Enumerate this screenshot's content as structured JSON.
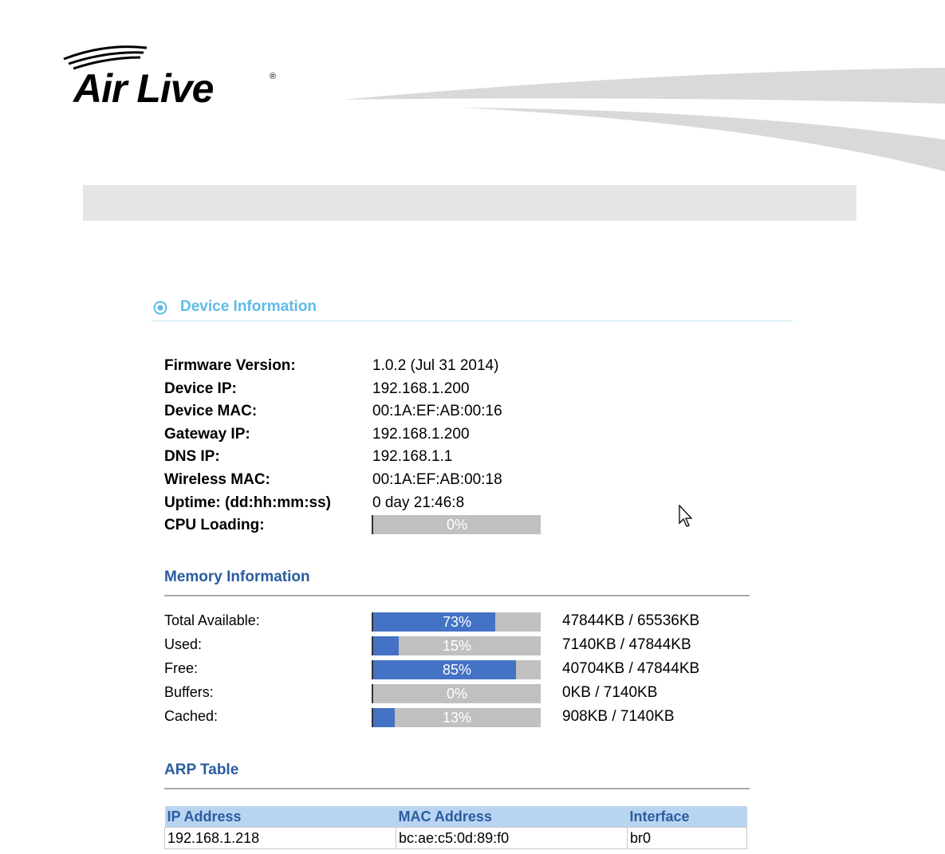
{
  "brand": {
    "logo_text": "Air Live",
    "registered_mark": "®"
  },
  "device_information": {
    "title": "Device Information",
    "rows": [
      {
        "label": "Firmware Version:",
        "value": "1.0.2 (Jul 31 2014)"
      },
      {
        "label": "Device IP:",
        "value": "192.168.1.200"
      },
      {
        "label": "Device MAC:",
        "value": "00:1A:EF:AB:00:16"
      },
      {
        "label": "Gateway IP:",
        "value": "192.168.1.200"
      },
      {
        "label": "DNS IP:",
        "value": "192.168.1.1"
      },
      {
        "label": "Wireless MAC:",
        "value": "00:1A:EF:AB:00:18"
      },
      {
        "label": "Uptime: (dd:hh:mm:ss)",
        "value": "0 day 21:46:8"
      }
    ],
    "cpu": {
      "label": "CPU Loading:",
      "percent_text": "0%",
      "percent": 0
    }
  },
  "memory_information": {
    "title": "Memory Information",
    "rows": [
      {
        "label": "Total Available:",
        "percent_text": "73%",
        "percent": 73,
        "value": "47844KB / 65536KB"
      },
      {
        "label": "Used:",
        "percent_text": "15%",
        "percent": 15,
        "value": "7140KB / 47844KB"
      },
      {
        "label": "Free:",
        "percent_text": "85%",
        "percent": 85,
        "value": "40704KB / 47844KB"
      },
      {
        "label": "Buffers:",
        "percent_text": "0%",
        "percent": 0,
        "value": "0KB / 7140KB"
      },
      {
        "label": "Cached:",
        "percent_text": "13%",
        "percent": 13,
        "value": "908KB / 7140KB"
      }
    ]
  },
  "arp_table": {
    "title": "ARP Table",
    "headers": {
      "ip": "IP Address",
      "mac": "MAC Address",
      "interface": "Interface"
    },
    "rows": [
      {
        "ip": "192.168.1.218",
        "mac": "bc:ae:c5:0d:89:f0",
        "interface": "br0"
      }
    ]
  },
  "colors": {
    "accent": "#5fbbe6",
    "subheading": "#2a5d9f",
    "bar_fill": "#4472c4",
    "bar_bg": "#c0c0c0",
    "table_header": "#b9d4f1"
  }
}
